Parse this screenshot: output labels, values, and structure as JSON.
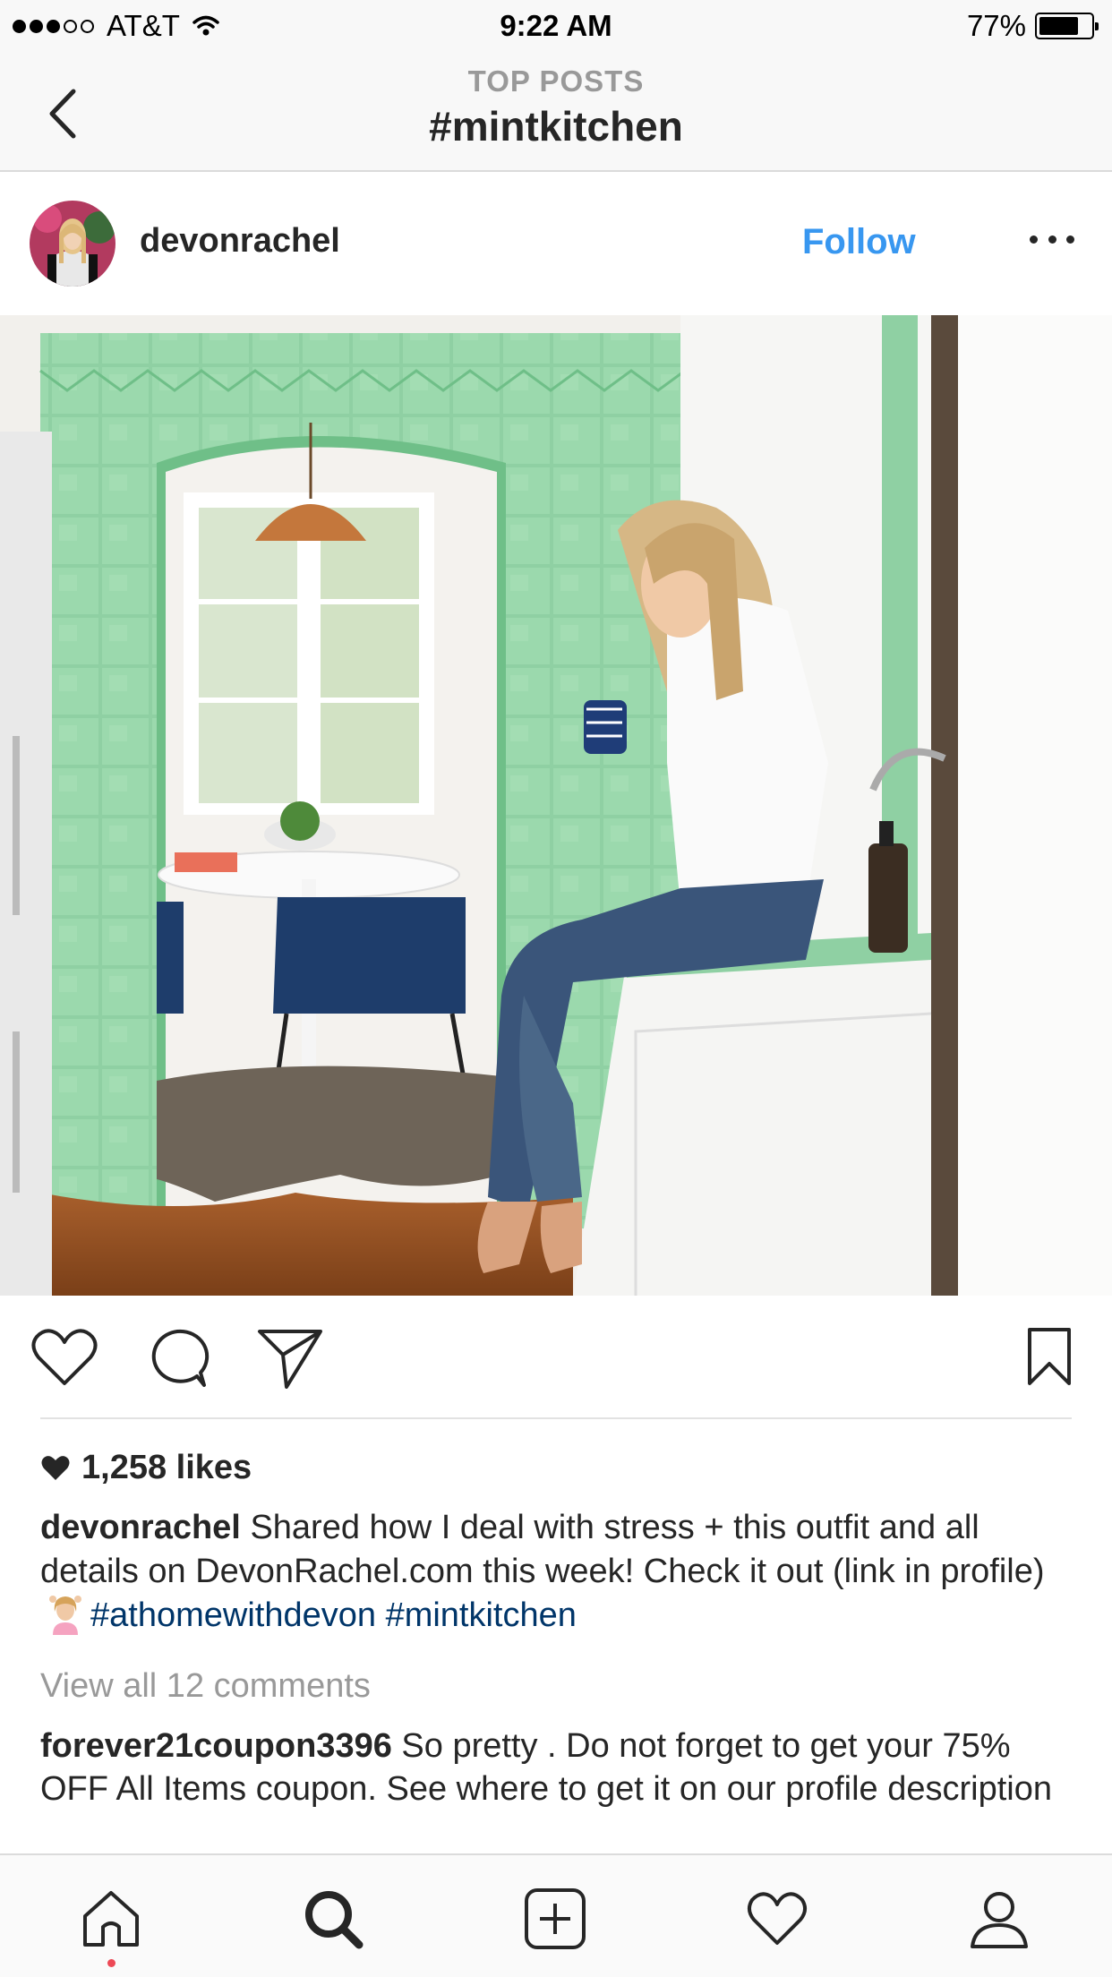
{
  "status_bar": {
    "carrier": "AT&T",
    "time": "9:22 AM",
    "battery_percent": "77%",
    "battery_level": 0.77,
    "signal_bars_filled": 3,
    "signal_bars_total": 5
  },
  "nav": {
    "subtitle": "TOP POSTS",
    "title": "#mintkitchen",
    "back_icon": "chevron-left-icon"
  },
  "post": {
    "username": "devonrachel",
    "follow_label": "Follow",
    "more_icon": "more-horizontal-icon",
    "photo_alt": "woman-sitting-on-mint-tiled-kitchen-counter",
    "likes": "1,258 likes",
    "caption": {
      "author": "devonrachel",
      "text": "Shared how I deal with stress + this outfit and all details on DevonRachel.com this week! Check it out (link in profile)",
      "hashtags": [
        "#athomewithdevon",
        "#mintkitchen"
      ]
    },
    "view_all_comments": "View all 12 comments",
    "comment": {
      "author": "forever21coupon3396",
      "text": "So pretty . Do not forget to get your 75% OFF All Items coupon. See where to get it on our profile description"
    }
  },
  "actions": [
    "heart-icon",
    "comment-icon",
    "share-icon",
    "bookmark-icon"
  ],
  "tabbar": {
    "items": [
      "home-icon",
      "search-icon",
      "add-post-icon",
      "activity-heart-icon",
      "profile-icon"
    ],
    "active": "search-icon",
    "accent": "#262626"
  },
  "colors": {
    "link_blue": "#3897f0",
    "hashtag_blue": "#003569",
    "muted_gray": "#999999",
    "notification_red": "#ed4956"
  }
}
